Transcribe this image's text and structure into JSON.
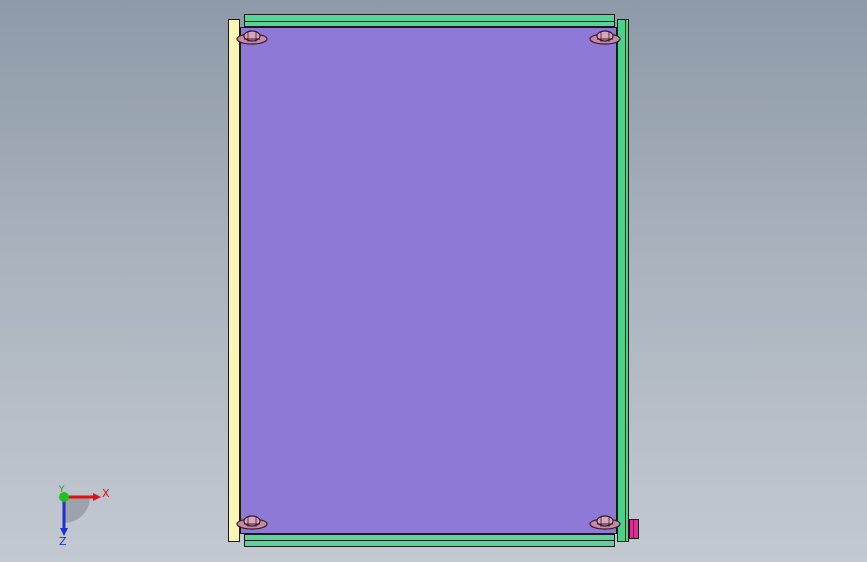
{
  "viewport": {
    "background_top": "#8e9aa8",
    "background_bottom": "#c3c9d1"
  },
  "model": {
    "panel_color": "#8e79d6",
    "top_rail_color": "#59d39a",
    "bottom_rail_color": "#59d39a",
    "left_rail_color": "#fbf6b6",
    "right_rail_color": "#4fcf8c",
    "connector_color": "#e22a9a",
    "fastener_color": "#c48aa6",
    "fastener_count": 4
  },
  "triad": {
    "x_label": "X",
    "y_label": "Y",
    "z_label": "Z",
    "x_color": "#e01010",
    "y_color": "#20c020",
    "z_color": "#2030d0"
  }
}
